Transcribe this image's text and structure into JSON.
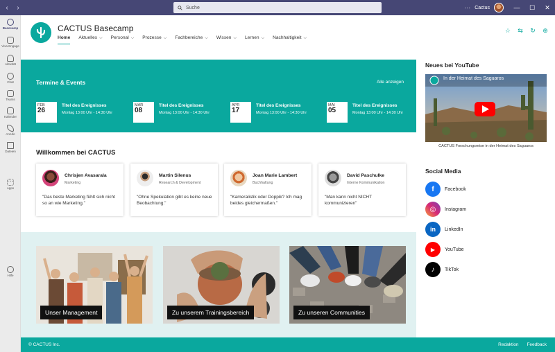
{
  "titlebar": {
    "search_placeholder": "Suche",
    "more": "···",
    "user": "Cactus"
  },
  "rail": [
    {
      "label": "Basecamp",
      "icon": "cactus-icon"
    },
    {
      "label": "Viva Engage",
      "icon": "viva-engage-icon"
    },
    {
      "label": "Aktivität",
      "icon": "bell-icon"
    },
    {
      "label": "Chat",
      "icon": "chat-icon"
    },
    {
      "label": "Teams",
      "icon": "teams-icon"
    },
    {
      "label": "Kalender",
      "icon": "calendar-icon"
    },
    {
      "label": "Anrufe",
      "icon": "phone-icon"
    },
    {
      "label": "Dateien",
      "icon": "file-icon"
    },
    {
      "label": "Apps",
      "icon": "apps-icon"
    },
    {
      "label": "Hilfe",
      "icon": "help-icon"
    }
  ],
  "rail_more": "···",
  "site": {
    "title": "CACTUS Basecamp",
    "nav": [
      "Home",
      "Aktuelles",
      "Personal",
      "Prozesse",
      "Fachbereiche",
      "Wissen",
      "Lernen",
      "Nachhaltigkeit"
    ]
  },
  "events": {
    "title": "Termine & Events",
    "show_all": "Alle anzeigen",
    "items": [
      {
        "month": "FEB",
        "day": "26",
        "name": "Titel des Ereignisses",
        "time": "Montag 13:00 Uhr - 14:30 Uhr"
      },
      {
        "month": "MÄR",
        "day": "08",
        "name": "Titel des Ereignisses",
        "time": "Montag 13:00 Uhr - 14:30 Uhr"
      },
      {
        "month": "APR",
        "day": "17",
        "name": "Titel des Ereignisses",
        "time": "Montag 13:00 Uhr - 14:30 Uhr"
      },
      {
        "month": "MAI",
        "day": "05",
        "name": "Titel des Ereignisses",
        "time": "Montag 13:00 Uhr - 14:30 Uhr"
      }
    ]
  },
  "welcome": {
    "title": "Willkommen bei CACTUS",
    "people": [
      {
        "name": "Chrisjen Avasarala",
        "role": "Marketing",
        "quote": "\"Das beste Marketing fühlt sich nicht so an wie Marketing.\""
      },
      {
        "name": "Martin Silenus",
        "role": "Research & Development",
        "quote": "\"Ohne Spekulation gibt es keine neue Beobachtung.\""
      },
      {
        "name": "Joan Marie Lambert",
        "role": "Buchhaltung",
        "quote": "\"Kameralistik oder Doppik? Ich mag beides gleichermaßen.\""
      },
      {
        "name": "David Paschulke",
        "role": "Interne Kommunikation",
        "quote": "\"Man kann nicht NICHT kommunizieren\""
      }
    ]
  },
  "tiles": [
    "Unser Management",
    "Zu unserem Trainingsbereich",
    "Zu unseren Communities"
  ],
  "youtube": {
    "title": "Neues bei YouTube",
    "video_title": "In der Heimat des Saguaros",
    "caption": "CACTUS Forschungsreise in der Heimat des Saguaros"
  },
  "social": {
    "title": "Social Media",
    "items": [
      {
        "label": "Facebook",
        "color": "#1877f2",
        "icon": "facebook-icon"
      },
      {
        "label": "Instagram",
        "color": "#d62976",
        "icon": "instagram-icon"
      },
      {
        "label": "LinkedIn",
        "color": "#0a66c2",
        "icon": "linkedin-icon"
      },
      {
        "label": "YouTube",
        "color": "#ff0000",
        "icon": "youtube-icon"
      },
      {
        "label": "TikTok",
        "color": "#010101",
        "icon": "tiktok-icon"
      }
    ]
  },
  "footer": {
    "copyright": "© CACTUS Inc.",
    "links": [
      "Redaktion",
      "Feedback"
    ]
  },
  "colors": {
    "accent": "#0aa89e",
    "titlebar": "#464775"
  }
}
